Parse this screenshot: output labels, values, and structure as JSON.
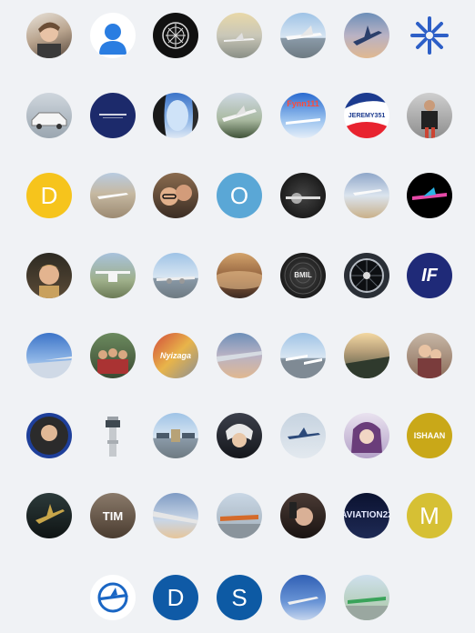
{
  "avatars": {
    "d_yellow": {
      "letter": "D",
      "color": "#f6c41c"
    },
    "o_blue": {
      "letter": "O",
      "color": "#5aa7d6"
    },
    "m_yellow": {
      "letter": "M",
      "color": "#d6c034"
    },
    "d_navy": {
      "letter": "D",
      "color": "#0f5aa6"
    },
    "s_navy": {
      "letter": "S",
      "color": "#0d5aa4"
    },
    "fynn": {
      "label": "Fynn111"
    },
    "jeremy": {
      "label": "JEREMY351"
    },
    "nyizaga": {
      "label": "Nyizaga"
    },
    "ishaan": {
      "label": "ISHAAN"
    },
    "tim": {
      "label": "TIM"
    },
    "aviation": {
      "label": "AVIATION22"
    },
    "if_logo": {
      "label": "IF"
    },
    "bmil": {
      "label": "BMIL"
    }
  },
  "colors": {
    "background": "#f0f2f5",
    "accent_blue": "#2d5fc7",
    "navy": "#1c2a6b"
  },
  "icons": [
    "default-user-icon",
    "rebel-emblem-icon",
    "asterisk-logo-icon"
  ]
}
